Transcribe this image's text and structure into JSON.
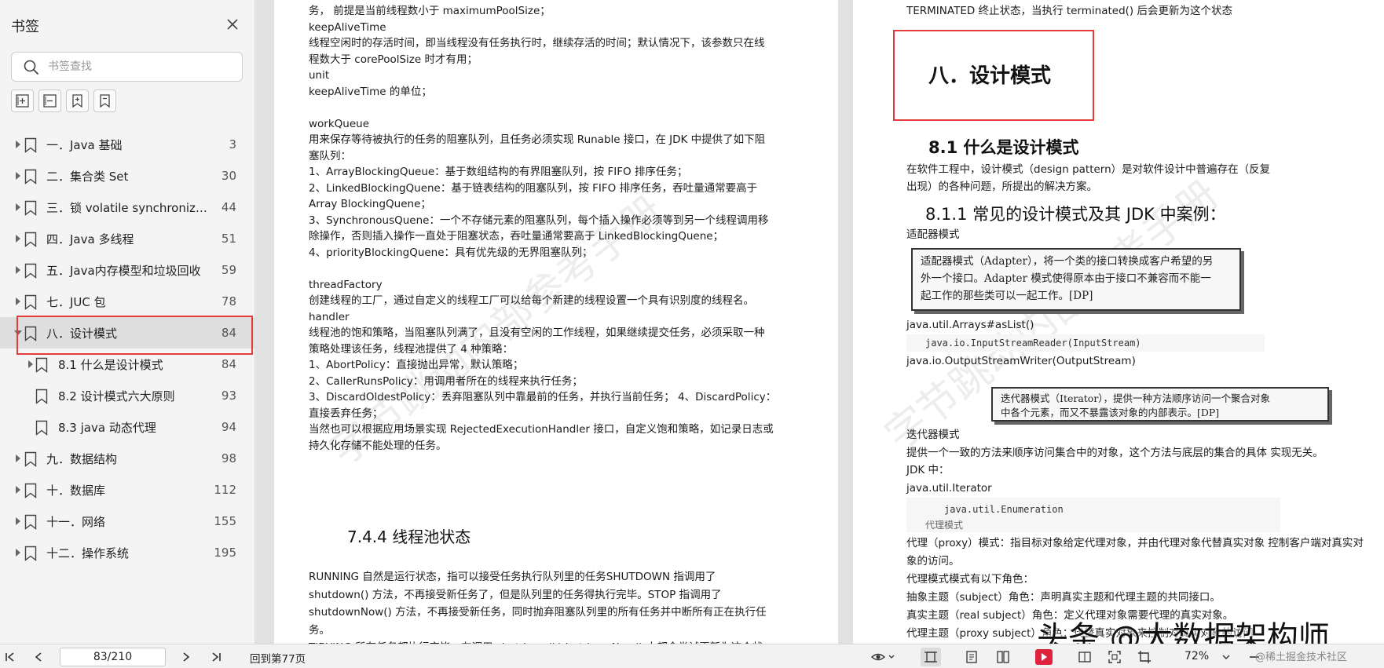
{
  "sidebar": {
    "title": "书签",
    "search_placeholder": "书签查找",
    "items": [
      {
        "label": "一．Java 基础",
        "page": "3",
        "level": 0
      },
      {
        "label": "二．集合类 Set",
        "page": "30",
        "level": 0
      },
      {
        "label": "三．锁 volatile synchronized...",
        "page": "44",
        "level": 0
      },
      {
        "label": "四．Java 多线程",
        "page": "51",
        "level": 0
      },
      {
        "label": "五．Java内存模型和垃圾回收",
        "page": "59",
        "level": 0
      },
      {
        "label": "七．JUC 包",
        "page": "78",
        "level": 0
      },
      {
        "label": "八．设计模式",
        "page": "84",
        "level": 0,
        "selected": true
      },
      {
        "label": "8.1 什么是设计模式",
        "page": "84",
        "level": 1
      },
      {
        "label": "8.2 设计模式六大原则",
        "page": "93",
        "level": 1
      },
      {
        "label": "8.3 java 动态代理",
        "page": "94",
        "level": 1
      },
      {
        "label": "九．数据结构",
        "page": "98",
        "level": 0
      },
      {
        "label": "十．数据库",
        "page": "112",
        "level": 0
      },
      {
        "label": "十一．网络",
        "page": "155",
        "level": 0
      },
      {
        "label": "十二．操作系统",
        "page": "195",
        "level": 0
      }
    ]
  },
  "left_page": {
    "lines": [
      "务， 前提是当前线程数小于 maximumPoolSize；",
      "keepAliveTime",
      "线程空闲时的存活时间，即当线程没有任务执行时，继续存活的时间；默认情况下，该参数只在线",
      "程数大于 corePoolSize 时才有用；",
      "unit",
      "keepAliveTime 的单位；",
      "",
      "workQueue",
      "用来保存等待被执行的任务的阻塞队列，且任务必须实现 Runable 接口，在 JDK 中提供了如下阻",
      "塞队列：",
      "1、ArrayBlockingQueue：基于数组结构的有界阻塞队列，按 FIFO 排序任务；",
      "2、LinkedBlockingQuene：基于链表结构的阻塞队列，按 FIFO 排序任务，吞吐量通常要高于",
      "Array BlockingQuene；",
      "3、SynchronousQuene：一个不存储元素的阻塞队列，每个插入操作必须等到另一个线程调用移",
      "除操作，否则插入操作一直处于阻塞状态，吞吐量通常要高于 LinkedBlockingQuene；",
      "4、priorityBlockingQuene：具有优先级的无界阻塞队列；",
      "",
      "threadFactory",
      "创建线程的工厂，通过自定义的线程工厂可以给每个新建的线程设置一个具有识别度的线程名。",
      "handler",
      "线程池的饱和策略，当阻塞队列满了，且没有空闲的工作线程，如果继续提交任务，必须采取一种",
      "策略处理该任务，线程池提供了 4 种策略：",
      "1、AbortPolicy：直接抛出异常，默认策略；",
      "2、CallerRunsPolicy：用调用者所在的线程来执行任务；",
      "3、DiscardOldestPolicy：丢弃阻塞队列中靠最前的任务，并执行当前任务；  4、DiscardPolicy：",
      "直接丢弃任务；",
      "当然也可以根据应用场景实现 RejectedExecutionHandler 接口，自定义饱和策略，如记录日志或",
      "持久化存储不能处理的任务。"
    ],
    "section_title": "7.4.4 线程池状态",
    "lines2": [
      "RUNNING 自然是运行状态，指可以接受任务执行队列里的任务SHUTDOWN 指调用了",
      "shutdown() 方法，不再接受新任务了，但是队列里的任务得执行完毕。STOP 指调用了",
      "shutdownNow() 方法，不再接受新任务，同时抛弃阻塞队列里的所有任务并中断所有正在执行任",
      "务。",
      "TIDYING 所有任务都执行完毕，在调用 shutdown()/shutdownNow() 中都会尝试更新为这个状"
    ],
    "watermark": "字节跳动内部参考手册"
  },
  "right_page": {
    "top_line": "TERMINATED 终止状态，当执行 terminated() 后会更新为这个状态",
    "chapter_title": "八．设计模式",
    "h3": "8.1 什么是设计模式",
    "intro1": "在软件工程中，设计模式（design pattern）是对软件设计中普遍存在（反复",
    "intro2": "出现）的各种问题，所提出的解决方案。",
    "h4": "8.1.1 常见的设计模式及其 JDK 中案例：",
    "adapter_label": "适配器模式",
    "adapter_quote": [
      "适配器模式（Adapter），将一个类的接口转换成客户希望的另",
      "外一个接口。Adapter 模式使得原本由于接口不兼容而不能一",
      "起工作的那些类可以一起工作。[DP]"
    ],
    "arrays_aslist": "java.util.Arrays#asList()",
    "code_reader": "java.io.InputStreamReader(InputStream)",
    "writer": "java.io.OutputStreamWriter(OutputStream)",
    "iterator_quote": [
      "迭代器模式（Iterator），提供一种方法顺序访问一个聚合对象",
      "中各个元素，而又不暴露该对象的内部表示。[DP]"
    ],
    "iterator_label": "迭代器模式",
    "iterator_desc": "提供一个一致的方法来顺序访问集合中的对象，这个方法与底层的集合的具体  实现无关。",
    "jdk": "JDK 中：",
    "iterator_class": "java.util.Iterator",
    "code_enum": "java.util.Enumeration",
    "proxy_small": "代理模式",
    "proxy1": "代理（proxy）模式：指目标对象给定代理对象，并由代理对象代替真实对象  控制客户端对真实对",
    "proxy2": "象的访问。",
    "proxy3": "代理模式模式有以下角色：",
    "proxy4": "抽象主题（subject）角色：声明真实主题和代理主题的共同接口。",
    "proxy5": "真实主题（real subject）角色：定义代理对象需要代理的真实对象。",
    "proxy6": "代理主题（proxy subject）角色：代替真实对象来控制对真实对象的访问",
    "watermark": "字节跳动内部参考手册"
  },
  "statusbar": {
    "page_value": "83/210",
    "goto": "回到第77页",
    "zoom": "72%"
  },
  "overlay": {
    "brand": "头条 @大数据架构师",
    "small": "@稀土掘金技术社区"
  },
  "colors": {
    "highlight": "#e23b3b",
    "play_button": "#e0233d"
  }
}
